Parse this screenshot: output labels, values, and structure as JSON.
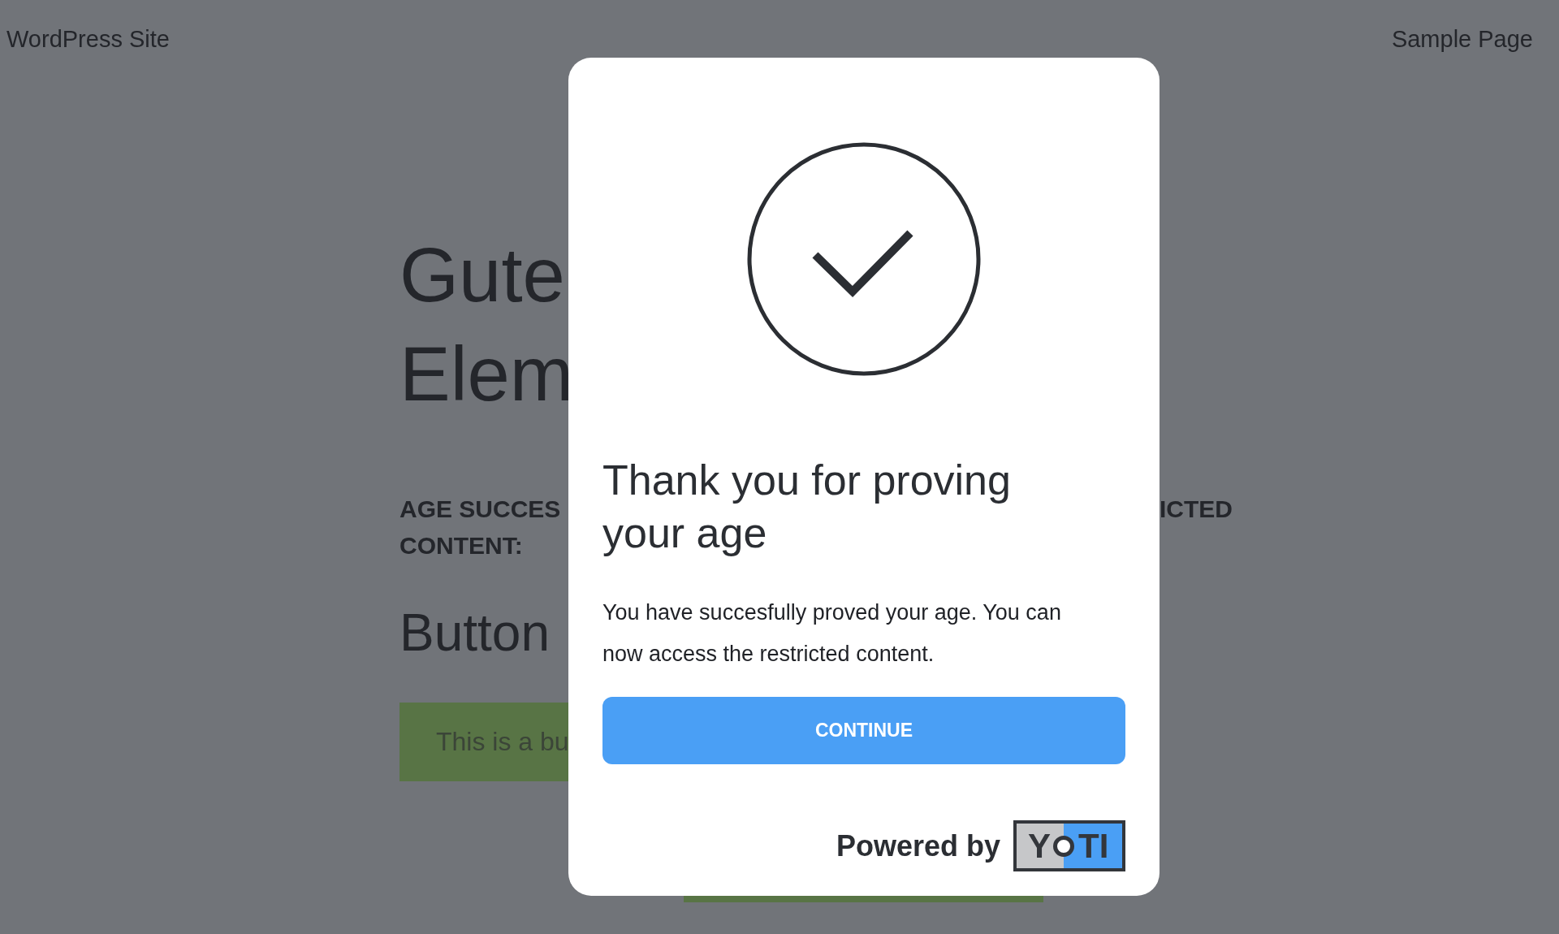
{
  "header": {
    "site_title": "WordPress Site",
    "nav_link": "Sample Page"
  },
  "background_page": {
    "title_lines": [
      "Gute",
      "Elem"
    ],
    "notice_lines": [
      "AGE SUCCES",
      "CONTENT:"
    ],
    "notice_right": "ICTED",
    "section_heading": "Button",
    "button_text": "This is a bu"
  },
  "dialog": {
    "title": "Thank you for proving your age",
    "message": "You have succesfully proved your age. You can now access the restricted content.",
    "button": "CONTINUE",
    "powered_by": "Powered by",
    "logo_left": "Y",
    "logo_right": "TI"
  }
}
